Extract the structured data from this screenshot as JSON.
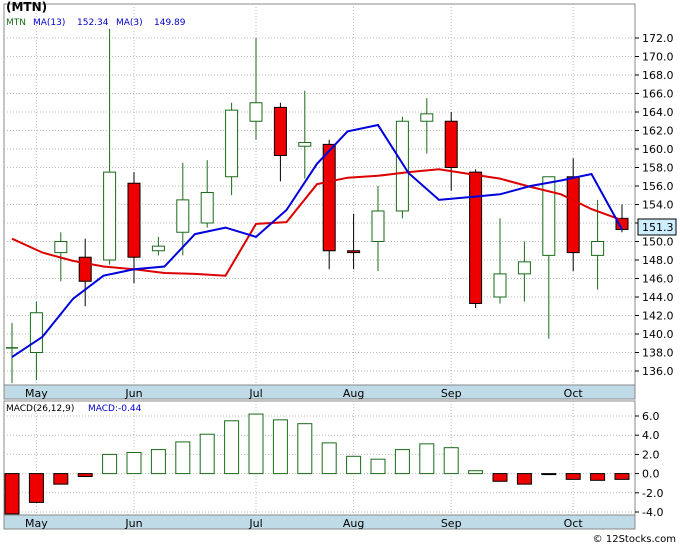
{
  "header": {
    "symbol": "(MTN)",
    "ticker": "MTN",
    "ma_long_label": "MA(13)",
    "ma_long_value": "152.34",
    "ma_short_label": "MA(3)",
    "ma_short_value": "149.89"
  },
  "macd_header": {
    "label": "MACD(26,12,9)",
    "value_label": "MACD:-0.44"
  },
  "current_price_label": "151.3",
  "watermark": "© 12Stocks.com",
  "colors": {
    "bull": "#1a6b1a",
    "bear": "#ee0000",
    "ma_long": "#dd0000",
    "ma_short": "#0000dd",
    "axis_bg": "#c0dbe8",
    "tag_bg": "#cdeeff"
  },
  "chart_data": [
    {
      "type": "candlestick",
      "title": "",
      "x_tick_labels": [
        "May",
        "Jun",
        "Jul",
        "Aug",
        "Sep",
        "Oct"
      ],
      "x_tick_bar_index": [
        1,
        5,
        10,
        14,
        18,
        23
      ],
      "ylim": [
        134,
        174
      ],
      "y_ticks": [
        "136.0",
        "138.0",
        "140.0",
        "142.0",
        "144.0",
        "146.0",
        "148.0",
        "150.0",
        "152.0",
        "154.0",
        "156.0",
        "158.0",
        "160.0",
        "162.0",
        "164.0",
        "166.0",
        "168.0",
        "170.0",
        "172.0"
      ],
      "grid": true,
      "candles": [
        {
          "o": 138.5,
          "h": 141.2,
          "l": 134.7,
          "c": 138.5
        },
        {
          "o": 138.0,
          "h": 143.5,
          "l": 135.0,
          "c": 142.3
        },
        {
          "o": 148.8,
          "h": 151.0,
          "l": 145.7,
          "c": 150.0
        },
        {
          "o": 148.3,
          "h": 150.3,
          "l": 143.0,
          "c": 145.7
        },
        {
          "o": 148.0,
          "h": 173.0,
          "l": 147.5,
          "c": 157.5
        },
        {
          "o": 156.3,
          "h": 157.5,
          "l": 145.5,
          "c": 148.3
        },
        {
          "o": 149.0,
          "h": 150.5,
          "l": 148.5,
          "c": 149.5
        },
        {
          "o": 151.0,
          "h": 158.5,
          "l": 148.5,
          "c": 154.5
        },
        {
          "o": 152.0,
          "h": 158.8,
          "l": 151.5,
          "c": 155.3
        },
        {
          "o": 157.0,
          "h": 165.0,
          "l": 155.0,
          "c": 164.2
        },
        {
          "o": 163.0,
          "h": 172.0,
          "l": 161.0,
          "c": 165.0
        },
        {
          "o": 164.5,
          "h": 165.0,
          "l": 156.5,
          "c": 159.3
        },
        {
          "o": 160.3,
          "h": 166.3,
          "l": 156.8,
          "c": 160.7
        },
        {
          "o": 160.5,
          "h": 161.0,
          "l": 147.0,
          "c": 149.0
        },
        {
          "o": 149.0,
          "h": 153.0,
          "l": 147.0,
          "c": 148.8
        },
        {
          "o": 150.0,
          "h": 156.0,
          "l": 146.8,
          "c": 153.3
        },
        {
          "o": 153.3,
          "h": 163.5,
          "l": 152.5,
          "c": 163.0
        },
        {
          "o": 163.0,
          "h": 165.5,
          "l": 159.5,
          "c": 163.8
        },
        {
          "o": 163.0,
          "h": 164.0,
          "l": 155.5,
          "c": 158.0
        },
        {
          "o": 157.5,
          "h": 157.8,
          "l": 142.8,
          "c": 143.3
        },
        {
          "o": 144.0,
          "h": 152.5,
          "l": 143.3,
          "c": 146.5
        },
        {
          "o": 146.5,
          "h": 150.0,
          "l": 143.5,
          "c": 147.8
        },
        {
          "o": 148.5,
          "h": 157.0,
          "l": 139.5,
          "c": 157.0
        },
        {
          "o": 157.0,
          "h": 159.0,
          "l": 146.8,
          "c": 148.8
        },
        {
          "o": 148.5,
          "h": 154.5,
          "l": 144.8,
          "c": 150.0
        },
        {
          "o": 152.5,
          "h": 154.0,
          "l": 151.0,
          "c": 151.3
        }
      ],
      "series": [
        {
          "name": "MA(13)",
          "color": "#dd0000",
          "points": [
            [
              0,
              150.3
            ],
            [
              1,
              148.8
            ],
            [
              2,
              147.9
            ],
            [
              3,
              147.3
            ],
            [
              4,
              147.0
            ],
            [
              5,
              146.6
            ],
            [
              6,
              146.5
            ],
            [
              7,
              146.3
            ],
            [
              8,
              151.9
            ],
            [
              9,
              152.1
            ],
            [
              10,
              156.2
            ],
            [
              11,
              156.9
            ],
            [
              12,
              157.1
            ],
            [
              13,
              157.5
            ],
            [
              14,
              157.8
            ],
            [
              15,
              157.3
            ],
            [
              16,
              156.8
            ],
            [
              17,
              155.9
            ],
            [
              18,
              155.1
            ],
            [
              19,
              153.5
            ],
            [
              20,
              152.3
            ]
          ]
        },
        {
          "name": "MA(3)",
          "color": "#0000dd",
          "points": [
            [
              0,
              137.5
            ],
            [
              1,
              139.7
            ],
            [
              2,
              143.8
            ],
            [
              3,
              146.3
            ],
            [
              4,
              147.0
            ],
            [
              5,
              147.3
            ],
            [
              6,
              150.8
            ],
            [
              7,
              151.5
            ],
            [
              8,
              150.5
            ],
            [
              9,
              153.4
            ],
            [
              10,
              158.4
            ],
            [
              11,
              161.9
            ],
            [
              12,
              162.6
            ],
            [
              13,
              157.4
            ],
            [
              14,
              154.5
            ],
            [
              15,
              154.8
            ],
            [
              16,
              155.1
            ],
            [
              17,
              156.0
            ],
            [
              18,
              156.6
            ],
            [
              19,
              157.3
            ],
            [
              20,
              151.3
            ]
          ]
        }
      ]
    },
    {
      "type": "bar",
      "title": "",
      "ylim": [
        -4.0,
        6.0
      ],
      "y_ticks": [
        "-4.0",
        "-2.0",
        "0.0",
        "2.0",
        "4.0",
        "6.0"
      ],
      "grid": true,
      "values": [
        -4.2,
        -3.0,
        -1.1,
        -0.3,
        2.0,
        2.2,
        2.5,
        3.3,
        4.1,
        5.5,
        6.2,
        5.6,
        5.2,
        3.2,
        1.8,
        1.5,
        2.5,
        3.1,
        2.7,
        0.3,
        -0.8,
        -1.1,
        -0.1,
        -0.6,
        -0.7,
        -0.6
      ]
    }
  ]
}
